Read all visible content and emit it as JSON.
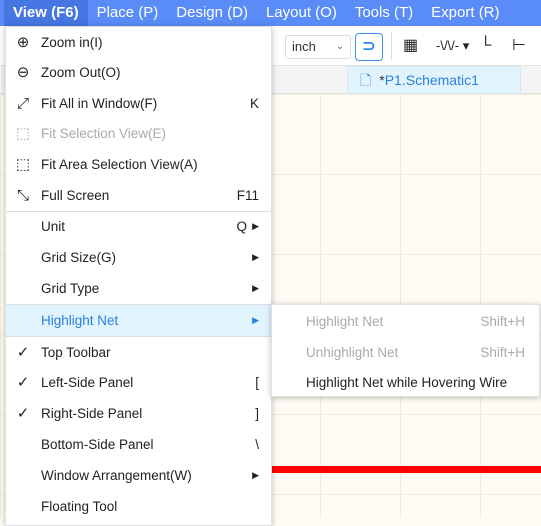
{
  "menubar": {
    "items": [
      "View (F6)",
      "Place (P)",
      "Design (D)",
      "Layout (O)",
      "Tools (T)",
      "Export (R)"
    ]
  },
  "toolbar": {
    "unit_value": "inch",
    "icons": [
      "magnet-icon",
      "chip-icon",
      "resistor-icon",
      "wire-icon",
      "netlabel-icon"
    ]
  },
  "tabs": [
    {
      "modified": "*",
      "name": "P1.Schematic1"
    }
  ],
  "canvas": {
    "wire_color": "#ff0000"
  },
  "view_menu": {
    "items": [
      {
        "label": "Zoom in(I)",
        "icon": "zoom-in-icon",
        "shortcut": "",
        "disabled": false
      },
      {
        "label": "Zoom Out(O)",
        "icon": "zoom-out-icon",
        "shortcut": "",
        "disabled": false
      },
      {
        "label": "Fit All in Window(F)",
        "icon": "fit-all-icon",
        "shortcut": "K",
        "disabled": false
      },
      {
        "label": "Fit Selection View(E)",
        "icon": "fit-selection-icon",
        "shortcut": "",
        "disabled": true
      },
      {
        "label": "Fit Area Selection View(A)",
        "icon": "fit-area-icon",
        "shortcut": "",
        "disabled": false
      },
      {
        "label": "Full Screen",
        "icon": "fullscreen-icon",
        "shortcut": "F11",
        "disabled": false
      },
      {
        "label": "Unit",
        "shortcut": "Q",
        "submenu": true
      },
      {
        "label": "Grid Size(G)",
        "submenu": true
      },
      {
        "label": "Grid Type",
        "submenu": true
      },
      {
        "label": "Highlight Net",
        "submenu": true,
        "highlighted": true
      },
      {
        "label": "Top Toolbar",
        "checked": true
      },
      {
        "label": "Left-Side Panel",
        "checked": true,
        "shortcut": "["
      },
      {
        "label": "Right-Side Panel",
        "checked": true,
        "shortcut": "]"
      },
      {
        "label": "Bottom-Side Panel",
        "checked": false,
        "shortcut": "\\"
      },
      {
        "label": "Window Arrangement(W)",
        "submenu": true
      },
      {
        "label": "Floating Tool"
      }
    ]
  },
  "highlight_submenu": {
    "items": [
      {
        "label": "Highlight Net",
        "shortcut": "Shift+H",
        "disabled": true
      },
      {
        "label": "Unhighlight Net",
        "shortcut": "Shift+H",
        "disabled": true
      },
      {
        "label": "Highlight Net while Hovering Wire",
        "shortcut": "",
        "disabled": false
      }
    ]
  },
  "colors": {
    "menubar": "#5a8cf7",
    "highlight_bg": "#e1f3fd",
    "accent": "#2a7fe0"
  }
}
